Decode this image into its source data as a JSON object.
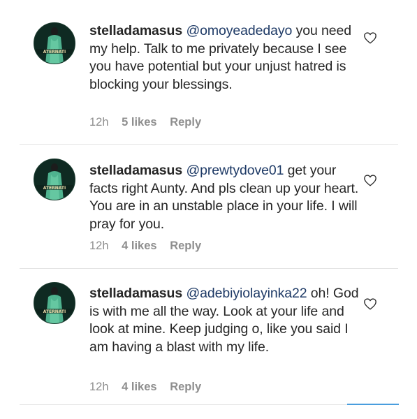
{
  "comments": [
    {
      "username": "stelladamasus",
      "mention": "@omoyeadedayo",
      "text": " you need my help. Talk to me privately because I see you have potential but your unjust hatred is blocking your blessings.",
      "time": "12h",
      "likes": "5 likes",
      "reply": "Reply",
      "avatar_text": "ATERNATI"
    },
    {
      "username": "stelladamasus",
      "mention": "@prewtydove01",
      "text": " get your facts right Aunty. And pls clean up your heart. You are in an unstable place in your life. I will pray for you.",
      "time": "12h",
      "likes": "4 likes",
      "reply": "Reply",
      "avatar_text": "ATERNATI"
    },
    {
      "username": "stelladamasus",
      "mention": "@adebiyiolayinka22",
      "text": " oh! God is with me all the way. Look at your life and look at mine. Keep judging o, like you said I am having a blast with my life.",
      "time": "12h",
      "likes": "4 likes",
      "reply": "Reply",
      "avatar_text": "ATERNATI"
    }
  ],
  "icons": {
    "like": "heart-outline-icon"
  },
  "colors": {
    "text": "#262626",
    "meta": "#8e8e8e",
    "mention": "#1e3a66",
    "avatar_bg": "#0f2a22",
    "avatar_figure": "#4fb38f",
    "accent_line": "#4a9ede"
  }
}
